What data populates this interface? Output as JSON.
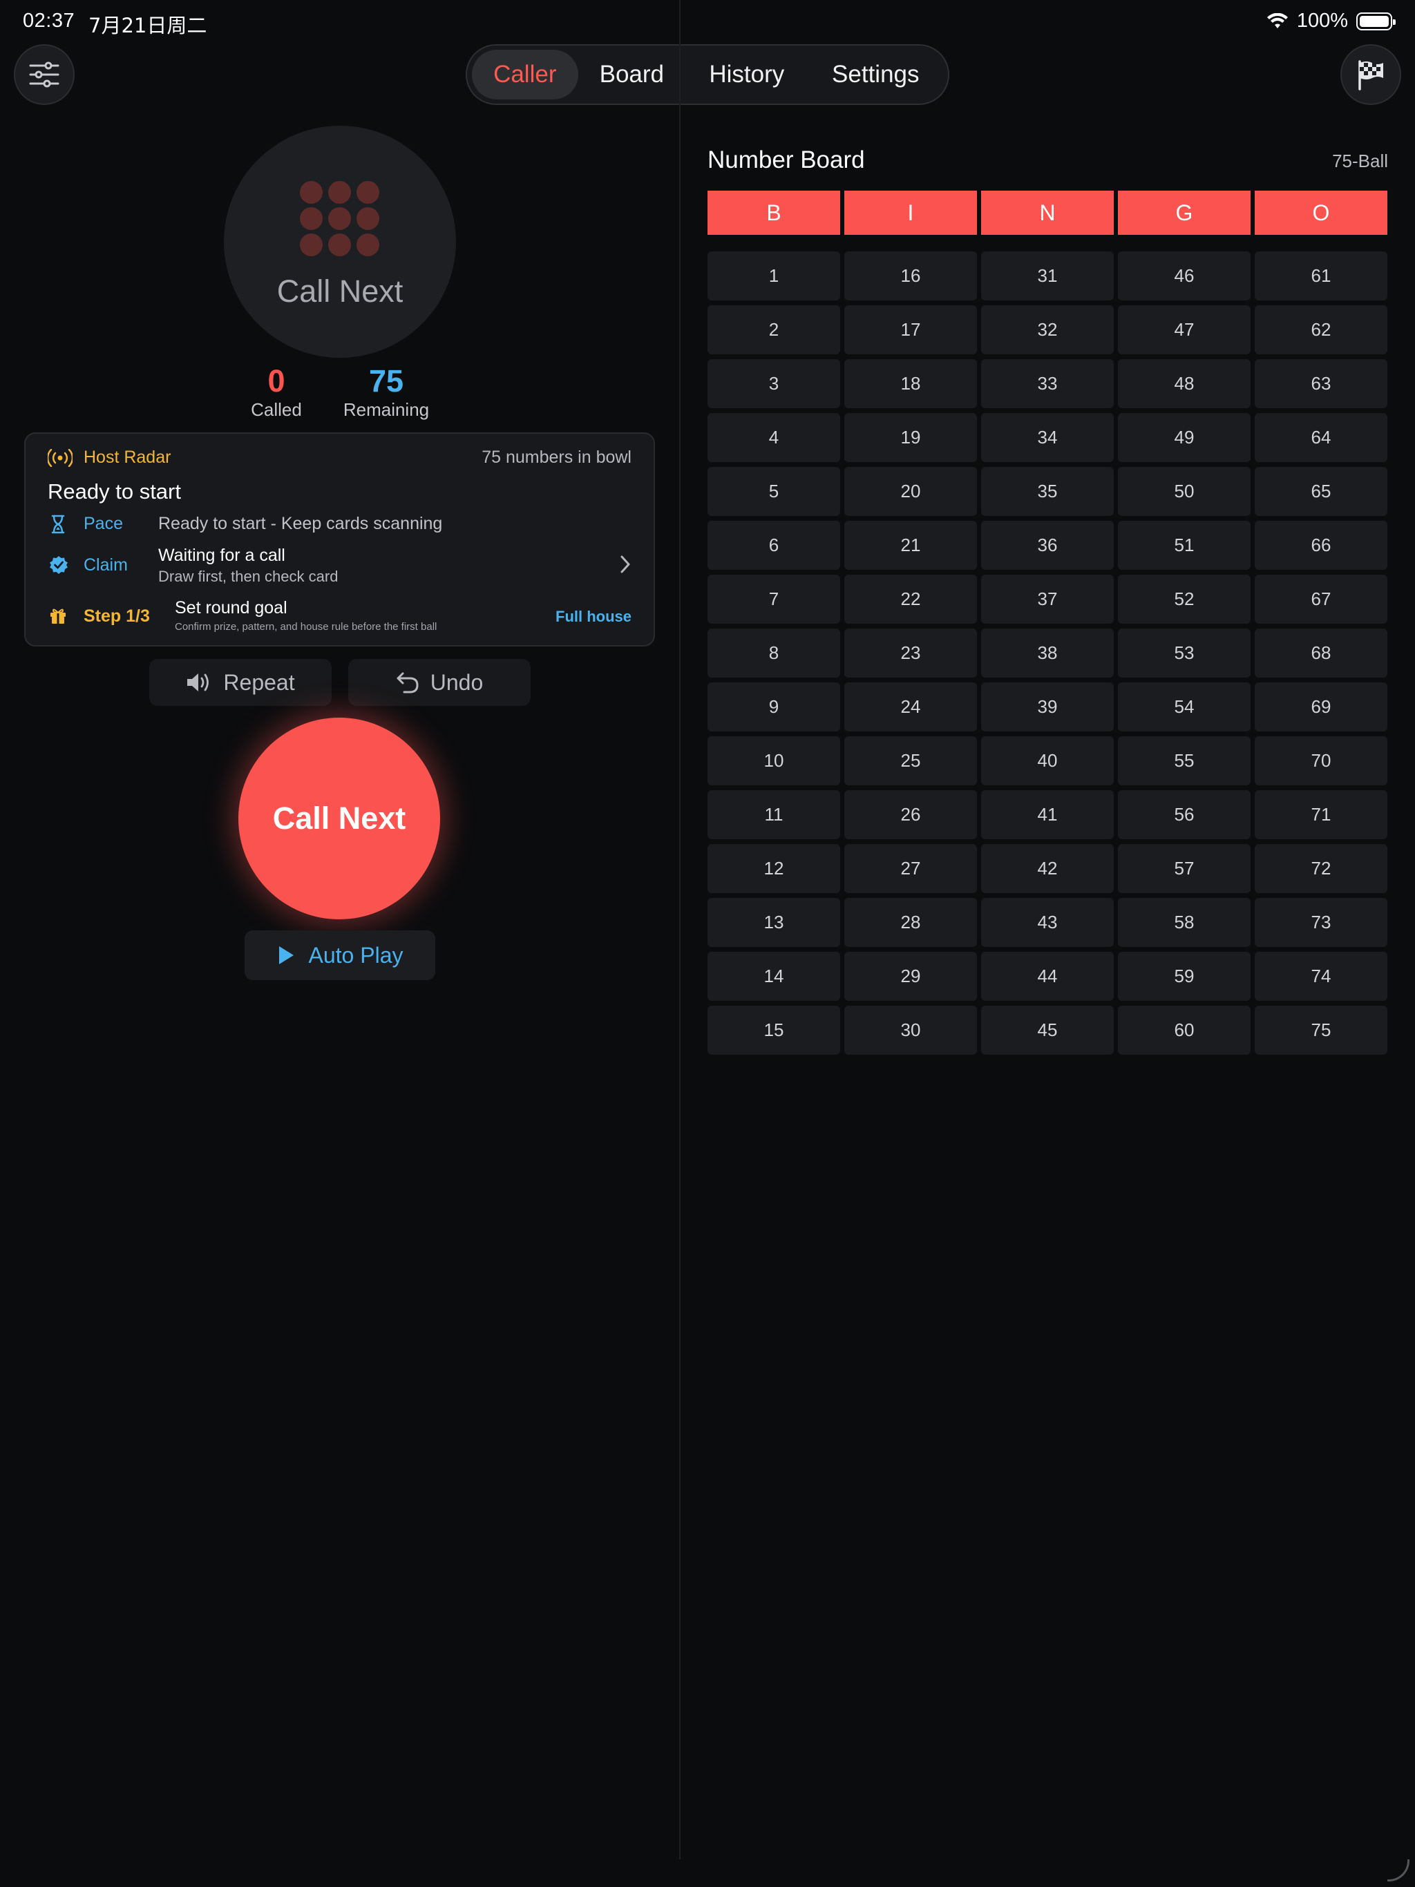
{
  "status_bar": {
    "time": "02:37",
    "date": "7月21日周二",
    "battery": "100%"
  },
  "tabs": [
    {
      "label": "Caller",
      "active": true
    },
    {
      "label": "Board",
      "active": false
    },
    {
      "label": "History",
      "active": false
    },
    {
      "label": "Settings",
      "active": false
    }
  ],
  "icons": {
    "filters": "sliders-icon",
    "finish": "checkered-flag-icon"
  },
  "caller": {
    "ball_label": "Call Next",
    "called_count": "0",
    "called_label": "Called",
    "remaining_count": "75",
    "remaining_label": "Remaining",
    "radar": {
      "title": "Host Radar",
      "bowl_info": "75 numbers in bowl",
      "headline": "Ready to start",
      "pace_label": "Pace",
      "pace_text": "Ready to start - Keep cards scanning",
      "claim_label": "Claim",
      "claim_title": "Waiting for a call",
      "claim_sub": "Draw first, then check card",
      "step_label": "Step 1/3",
      "step_title": "Set round goal",
      "step_sub": "Confirm prize, pattern, and house rule before the first ball",
      "step_action": "Full house"
    },
    "repeat_label": "Repeat",
    "undo_label": "Undo",
    "call_button": "Call Next",
    "auto_play": "Auto Play"
  },
  "board": {
    "title": "Number Board",
    "mode": "75-Ball",
    "headers": [
      "B",
      "I",
      "N",
      "G",
      "O"
    ]
  },
  "colors": {
    "accent": "#fb5450",
    "blue": "#4ab2ee",
    "gold": "#f5b731",
    "background": "#0b0c0e"
  }
}
